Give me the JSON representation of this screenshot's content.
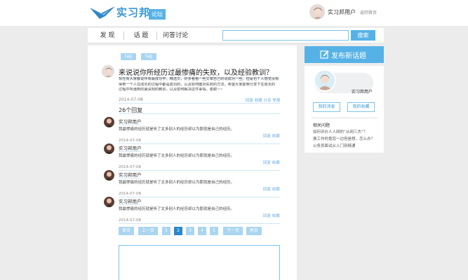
{
  "header": {
    "logo_text": "实习邦",
    "logo_tag": "论坛",
    "username": "实习邦用户",
    "home_link": "返回首页"
  },
  "nav": {
    "items": [
      "发 现",
      "话 题",
      "问答讨论"
    ],
    "search_placeholder": "",
    "search_button": "搜索"
  },
  "question": {
    "tags": [
      "tag",
      "tag"
    ],
    "title": "来说说你所经历过最惨痛的失败，以及经验教训？",
    "body_lines": [
      "现在有大家都说所有最成功学。精选文，好多看看一些文章自己的说成功一些。但是也个人感觉没有",
      "得到一个人在成长的过程中都是成功的，以及如何面对失败的方法。希望大家能够分享下在成长的",
      "过程中所遇到的最深刻的教训，以及如何解决这件事情。谢谢~~"
    ],
    "date": "2014-07-08",
    "actions": "回复  收藏  分享  举报"
  },
  "reply_count": "26个回复",
  "replies": [
    {
      "name": "实习邦用户",
      "text": "我最惨痛的经历就是听了太多别人的经历却以为那就是自己的经历。",
      "actions": "回复  收藏",
      "date": "2014-07-08"
    },
    {
      "name": "实习邦用户",
      "text": "我最惨痛的经历就是听了太多别人的经历却以为那就是自己的经历。",
      "actions": "回复  收藏",
      "date": "2014-07-08"
    },
    {
      "name": "实习邦用户",
      "text": "我最惨痛的经历就是听了太多别人的经历却以为那就是自己的经历。",
      "actions": "回复  收藏",
      "date": "2014-07-08"
    },
    {
      "name": "实习邦用户",
      "text": "我最惨痛的经历就是听了太多别人的经历却以为那就是自己的经历。",
      "actions": "回复  收藏",
      "date": "2014-07-08"
    }
  ],
  "pagination": {
    "first": "首页",
    "prev": "上一页",
    "pages": [
      "1",
      "2",
      "3",
      "4",
      "5"
    ],
    "current": "2",
    "next": "下一页",
    "last": "尾页"
  },
  "side": {
    "post_button": "发布新话题",
    "username": "实习邦用户",
    "my_messages": "我的消息",
    "my_favorites": "我的收藏",
    "related_title": "相关问题",
    "related": [
      "如何评价人人网的“从网三杰”？",
      "换工作时抱怨一边但是想，怎么办？",
      "公务员面试从入门到精通"
    ]
  },
  "colors": {
    "accent": "#56b2e6",
    "accent_dark": "#2a88c8",
    "tag_bg": "#aad5f1",
    "page_bg": "#ececec"
  }
}
